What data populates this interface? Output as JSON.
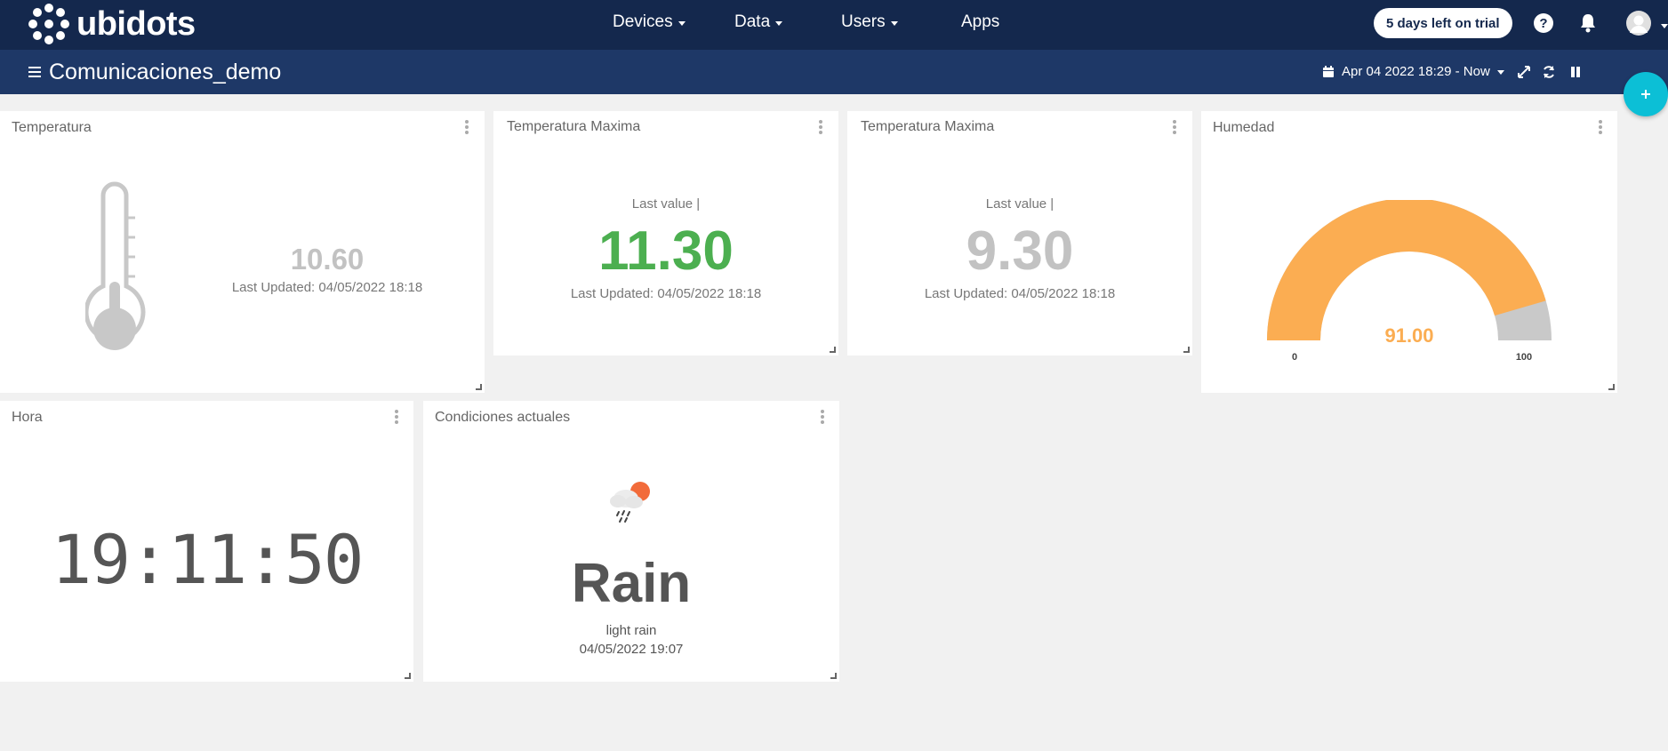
{
  "brand": {
    "name": "ubidots"
  },
  "nav": {
    "items": [
      {
        "label": "Devices",
        "caret": true
      },
      {
        "label": "Data",
        "caret": true
      },
      {
        "label": "Users",
        "caret": true
      },
      {
        "label": "Apps",
        "caret": false
      }
    ],
    "trial_label": "5 days left on trial"
  },
  "dashboard": {
    "title": "Comunicaciones_demo",
    "date_range": "Apr 04 2022 18:29 - Now"
  },
  "widgets": {
    "temperatura": {
      "title": "Temperatura",
      "value": "10.60",
      "updated": "Last Updated: 04/05/2022 18:18"
    },
    "temp_max_1": {
      "title": "Temperatura Maxima",
      "caption": "Last value |",
      "value": "11.30",
      "updated": "Last Updated: 04/05/2022 18:18",
      "color": "#4caf50"
    },
    "temp_max_2": {
      "title": "Temperatura Maxima",
      "caption": "Last value |",
      "value": "9.30",
      "updated": "Last Updated: 04/05/2022 18:18",
      "color": "#c2c2c2"
    },
    "humedad": {
      "title": "Humedad",
      "value": "91.00",
      "min": "0",
      "max": "100",
      "level": 0.91,
      "color": "#fbad52"
    },
    "hora": {
      "title": "Hora",
      "time": "19:11:50"
    },
    "condiciones": {
      "title": "Condiciones actuales",
      "condition": "Rain",
      "description": "light rain",
      "date": "04/05/2022 19:07"
    }
  },
  "colors": {
    "nav_bg": "#14284d",
    "subnav_bg": "#1e3867",
    "fab": "#0cbfd6",
    "gauge_rest": "#c9c9c9"
  }
}
